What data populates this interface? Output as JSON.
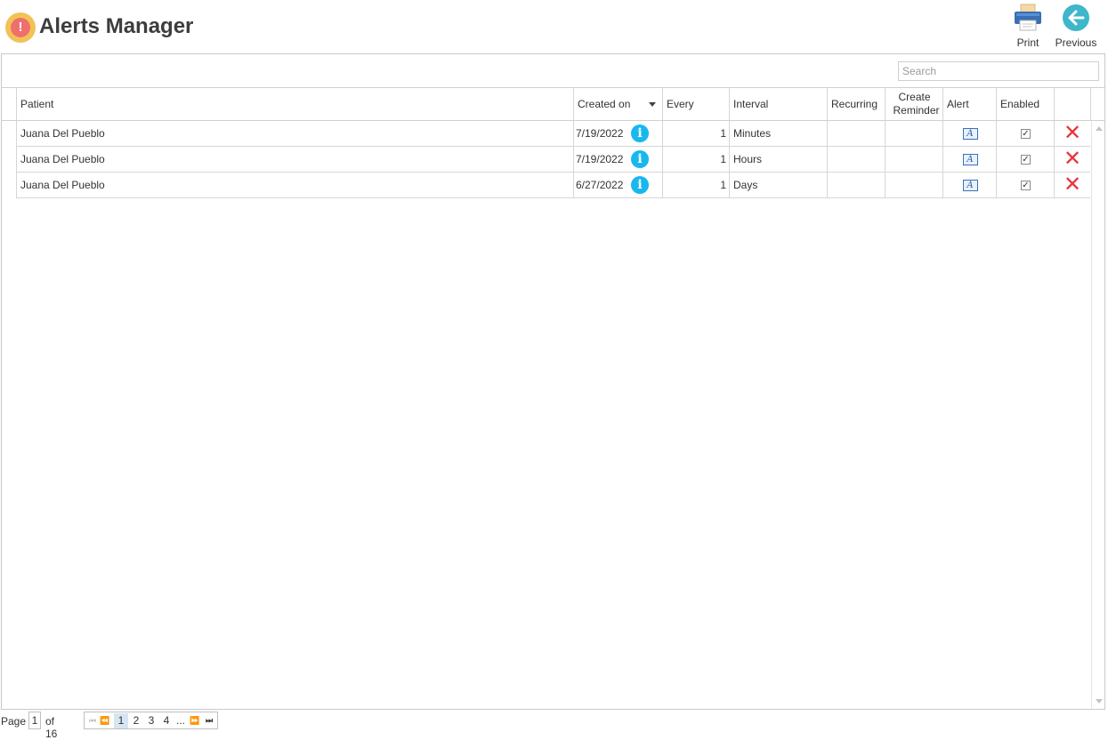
{
  "header": {
    "title": "Alerts Manager",
    "print_label": "Print",
    "previous_label": "Previous"
  },
  "search": {
    "placeholder": "Search"
  },
  "grid": {
    "columns": {
      "patient": "Patient",
      "created_on": "Created on",
      "every": "Every",
      "interval": "Interval",
      "recurring": "Recurring",
      "create_reminder": "Create Reminder",
      "alert": "Alert",
      "enabled": "Enabled"
    },
    "rows": [
      {
        "patient": "Juana Del Pueblo",
        "created_on": "7/19/2022",
        "every": "1",
        "interval": "Minutes",
        "enabled": true
      },
      {
        "patient": "Juana Del Pueblo",
        "created_on": "7/19/2022",
        "every": "1",
        "interval": "Hours",
        "enabled": true
      },
      {
        "patient": "Juana Del Pueblo",
        "created_on": "6/27/2022",
        "every": "1",
        "interval": "Days",
        "enabled": true
      }
    ]
  },
  "pager": {
    "page_label": "Page",
    "current_page": "1",
    "of_label": "of 16",
    "pages": [
      "1",
      "2",
      "3",
      "4",
      "..."
    ]
  },
  "icons": {
    "app": "alert-exclamation-icon",
    "print": "printer-icon",
    "previous": "arrow-left-circle-icon",
    "info": "info-icon",
    "alert": "alert-text-icon",
    "delete": "delete-x-icon"
  },
  "colors": {
    "app_icon_outer": "#f2c257",
    "app_icon_inner": "#ef6f6c",
    "info_blue": "#18b8ef",
    "delete_red": "#e8343a",
    "previous_teal": "#3fb6c9",
    "printer_blue": "#3a6fb3"
  }
}
